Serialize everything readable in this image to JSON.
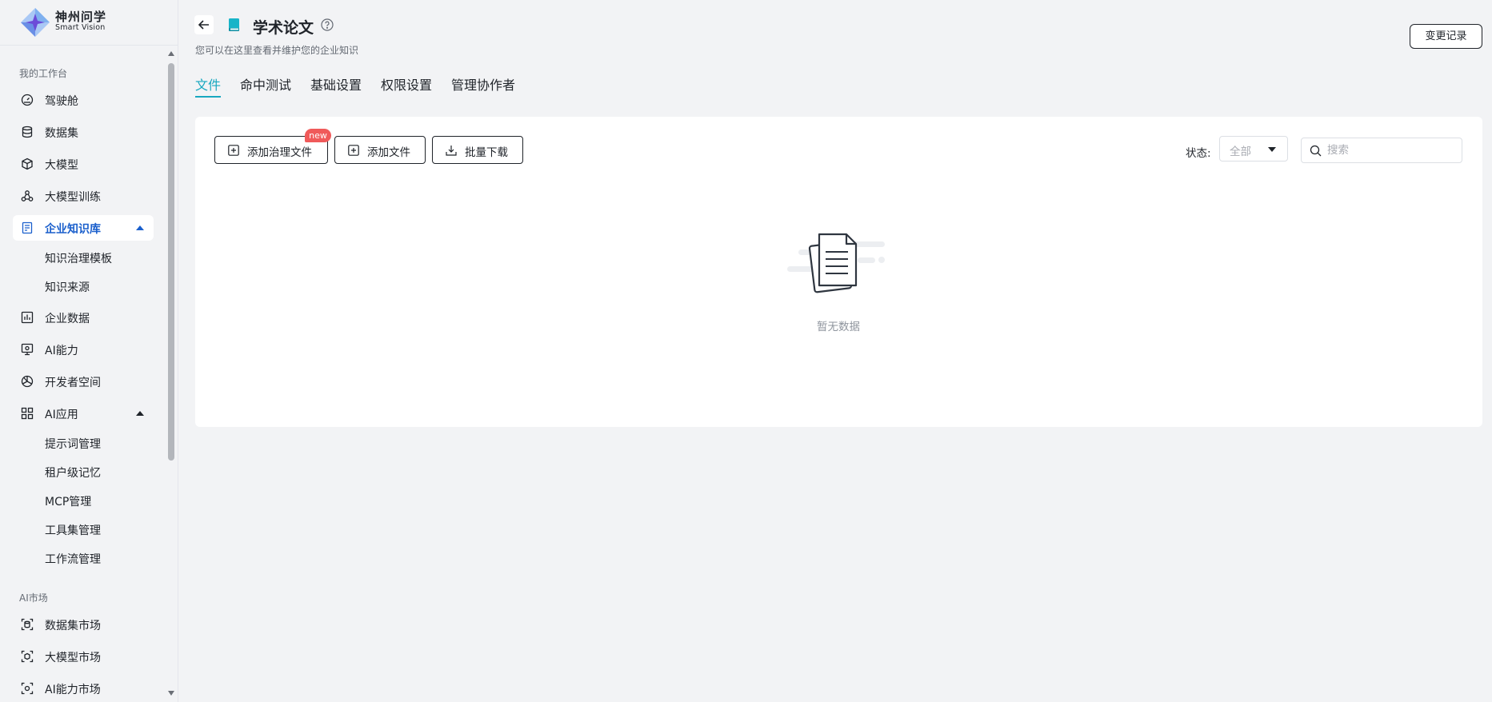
{
  "brand": {
    "name": "神州问学",
    "subtitle": "Smart Vision"
  },
  "sidebar": {
    "workbench_title": "我的工作台",
    "items": [
      {
        "label": "驾驶舱",
        "icon": "dashboard-icon"
      },
      {
        "label": "数据集",
        "icon": "database-icon"
      },
      {
        "label": "大模型",
        "icon": "cube-icon"
      },
      {
        "label": "大模型训练",
        "icon": "training-icon"
      },
      {
        "label": "企业知识库",
        "icon": "knowledge-base-icon",
        "active": true,
        "expanded": true,
        "children": [
          {
            "label": "知识治理模板"
          },
          {
            "label": "知识来源"
          }
        ]
      },
      {
        "label": "企业数据",
        "icon": "bar-chart-icon"
      },
      {
        "label": "AI能力",
        "icon": "ai-monitor-icon"
      },
      {
        "label": "开发者空间",
        "icon": "developer-icon"
      },
      {
        "label": "AI应用",
        "icon": "app-grid-icon",
        "expanded": true,
        "children": [
          {
            "label": "提示词管理"
          },
          {
            "label": "租户级记忆"
          },
          {
            "label": "MCP管理"
          },
          {
            "label": "工具集管理"
          },
          {
            "label": "工作流管理"
          }
        ]
      }
    ],
    "market_title": "AI市场",
    "market_items": [
      {
        "label": "数据集市场",
        "icon": "dataset-market-icon"
      },
      {
        "label": "大模型市场",
        "icon": "model-market-icon"
      },
      {
        "label": "AI能力市场",
        "icon": "ai-market-icon"
      }
    ]
  },
  "header": {
    "title": "学术论文",
    "subtitle": "您可以在这里查看并维护您的企业知识",
    "change_log": "变更记录"
  },
  "tabs": [
    {
      "label": "文件",
      "active": true
    },
    {
      "label": "命中测试"
    },
    {
      "label": "基础设置"
    },
    {
      "label": "权限设置"
    },
    {
      "label": "管理协作者"
    }
  ],
  "toolbar": {
    "add_governance_file": "添加治理文件",
    "new_badge": "new",
    "add_file": "添加文件",
    "batch_download": "批量下载",
    "status_label": "状态:",
    "status_value": "全部",
    "search_placeholder": "搜索"
  },
  "empty": {
    "text": "暂无数据"
  },
  "colors": {
    "accent": "#18a8c0",
    "sidebar_active": "#1a5fcc",
    "badge": "#f05a5a"
  }
}
